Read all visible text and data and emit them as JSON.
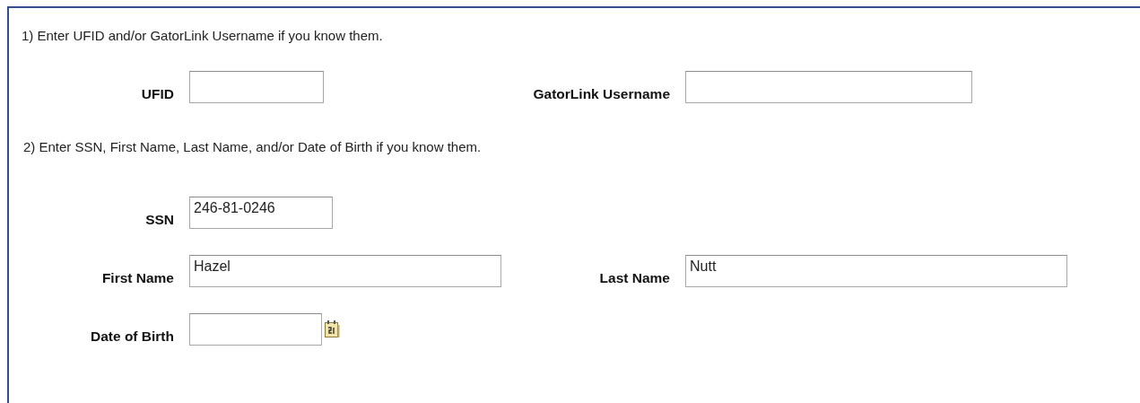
{
  "sections": [
    {
      "title": "1) Enter UFID and/or GatorLink Username if you know them.",
      "rows": [
        [
          {
            "label": "UFID"
          },
          {
            "label": "GatorLink Username"
          }
        ]
      ]
    },
    {
      "title": "2) Enter SSN, First Name, Last Name, and/or Date of Birth if you know them.",
      "rows": [
        [
          {
            "label": "SSN",
            "value": "246-81-0246"
          }
        ],
        [
          {
            "label": "First Name",
            "value": "Hazel"
          },
          {
            "label": "Last Name",
            "value": "Nutt"
          }
        ],
        [
          {
            "label": "Date of Birth",
            "kind": "date"
          }
        ]
      ]
    }
  ]
}
